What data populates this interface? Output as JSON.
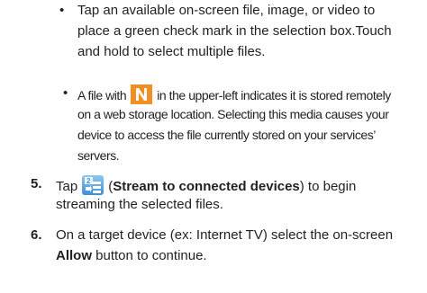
{
  "bullet_glyph": "•",
  "bullet1": {
    "line1": "Tap an available on-screen file, image, or video to",
    "line2": "place a green check mark in the selection box.Touch",
    "line3": "and hold to select multiple files."
  },
  "bullet2": {
    "line1_pre": "A file with",
    "line1_post": "in the upper-left indicates it is stored remotely",
    "line2": "on a web storage location. Selecting this media causes your",
    "line3": "device to access the file currently stored on your services’",
    "line4": "servers."
  },
  "step5": {
    "number": "5.",
    "pre": "Tap",
    "paren_open": "(",
    "bold": "Stream to connected devices",
    "post": ") to begin",
    "line2": "streaming the selected files."
  },
  "step6": {
    "number": "6.",
    "line1": "On a target device (ex: Internet TV) select the on-screen",
    "bold": "Allow",
    "line2_post": " button to continue."
  },
  "colors": {
    "text": "#231f20",
    "n_icon_bg": "#f18e24",
    "stream_icon": "#3d8fd6"
  },
  "icons": {
    "remote_storage": "n-icon",
    "stream": "stream-to-devices-icon"
  }
}
